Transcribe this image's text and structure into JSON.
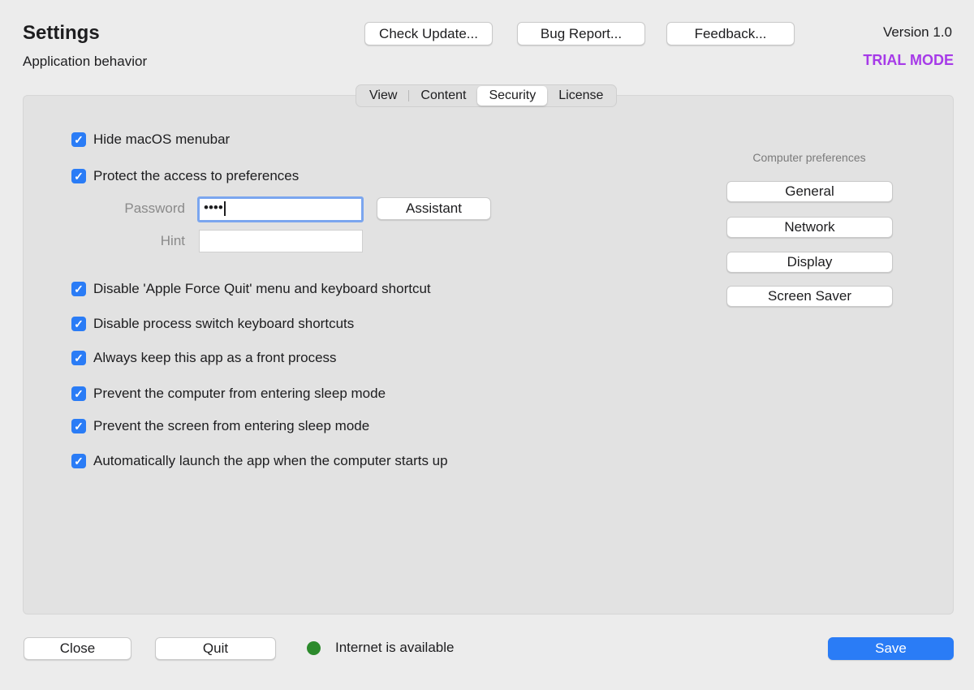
{
  "header": {
    "title": "Settings",
    "subtitle": "Application behavior",
    "version": "Version 1.0",
    "trial_mode": "TRIAL MODE",
    "buttons": [
      "Check Update...",
      "Bug Report...",
      "Feedback..."
    ]
  },
  "tabs": [
    {
      "label": "View",
      "selected": false
    },
    {
      "label": "Content",
      "selected": false
    },
    {
      "label": "Security",
      "selected": true
    },
    {
      "label": "License",
      "selected": false
    }
  ],
  "security": {
    "checkboxes": [
      {
        "label": "Hide macOS menubar",
        "checked": true
      },
      {
        "label": "Protect the access to preferences",
        "checked": true
      },
      {
        "label": "Disable 'Apple Force Quit' menu and keyboard shortcut",
        "checked": true
      },
      {
        "label": "Disable process switch keyboard shortcuts",
        "checked": true
      },
      {
        "label": "Always keep this app as a front process",
        "checked": true
      },
      {
        "label": "Prevent the computer from entering sleep mode",
        "checked": true
      },
      {
        "label": "Prevent the screen from entering sleep mode",
        "checked": true
      },
      {
        "label": "Automatically launch the app when the computer starts up",
        "checked": true
      }
    ],
    "password_label": "Password",
    "password_value": "••••",
    "assistant_label": "Assistant",
    "hint_label": "Hint",
    "hint_value": ""
  },
  "computer_preferences": {
    "title": "Computer preferences",
    "buttons": [
      "General",
      "Network",
      "Display",
      "Screen Saver"
    ]
  },
  "footer": {
    "close_label": "Close",
    "quit_label": "Quit",
    "status_text": "Internet is available",
    "status_color": "#2c8a2c",
    "save_label": "Save"
  },
  "colors": {
    "accent": "#2a7cf6",
    "trial": "#a63ae8"
  }
}
